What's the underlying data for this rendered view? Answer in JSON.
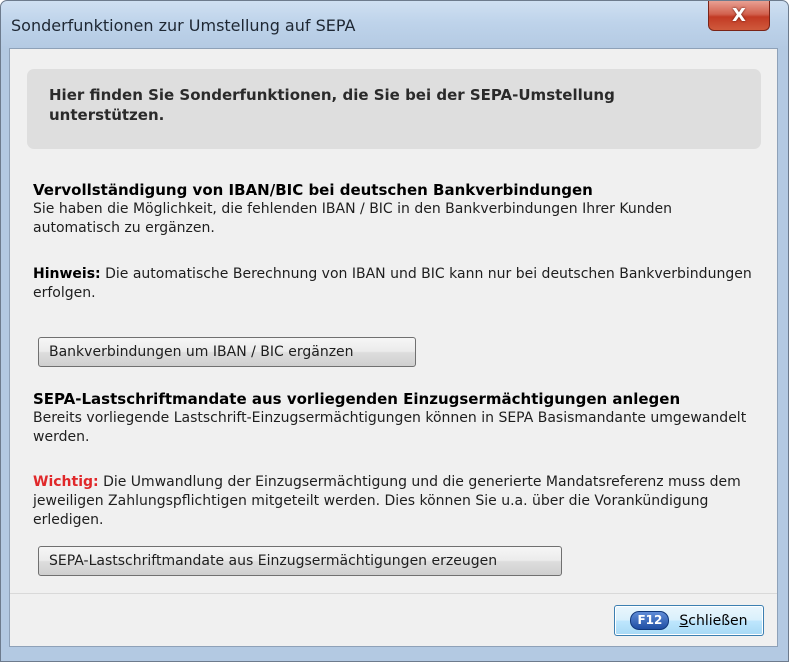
{
  "window": {
    "title": "Sonderfunktionen zur Umstellung auf SEPA",
    "close_glyph": "X"
  },
  "info": {
    "text": "Hier finden Sie Sonderfunktionen, die Sie bei der SEPA-Umstellung unterstützen."
  },
  "iban_section": {
    "heading": "Vervollständigung von IBAN/BIC bei deutschen Bankverbindungen",
    "description": "Sie haben die Möglichkeit, die fehlenden IBAN / BIC in den Bankverbindungen Ihrer Kunden automatisch zu ergänzen.",
    "hint_label": "Hinweis:",
    "hint_text": " Die automatische Berechnung von IBAN und BIC kann nur bei deutschen Bankverbindungen erfolgen.",
    "button_label": "Bankverbindungen um IBAN / BIC ergänzen"
  },
  "sepa_section": {
    "heading": "SEPA-Lastschriftmandate aus vorliegenden Einzugsermächtigungen anlegen",
    "description": "Bereits vorliegende Lastschrift-Einzugsermächtigungen können in SEPA Basismandante umgewandelt werden.",
    "warning_label": "Wichtig:",
    "warning_text": " Die Umwandlung der Einzugsermächtigung und die generierte Mandatsreferenz muss dem jeweiligen Zahlungspflichtigen mitgeteilt werden. Dies können Sie u.a. über die Vorankündigung erledigen.",
    "button_label": "SEPA-Lastschriftmandate aus Einzugsermächtigungen erzeugen"
  },
  "footer": {
    "key_badge": "F12",
    "close_mnemonic": "S",
    "close_rest": "chließen"
  },
  "colors": {
    "warning": "#e0282a",
    "close_button_red": "#c23a24",
    "default_button_blue": "#3c7fb1"
  },
  "icons": {
    "window_close": "close-icon"
  }
}
